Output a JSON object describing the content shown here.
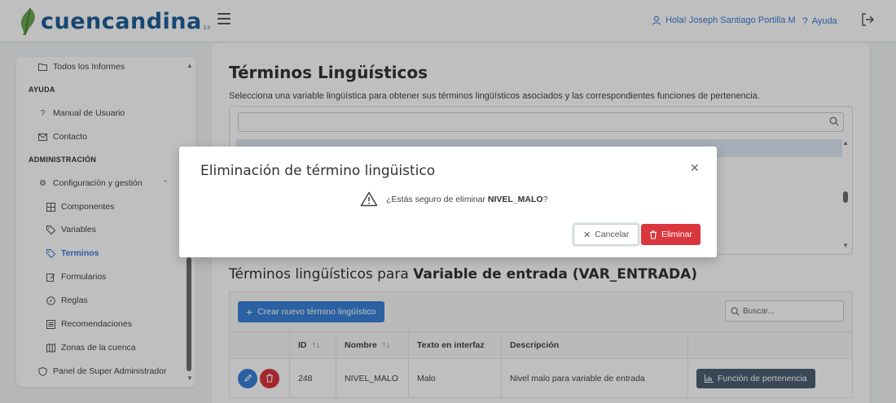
{
  "header": {
    "brand": "cuencandina",
    "version": "2.0",
    "greeting": "Hola! Joseph Santiago Portilla M",
    "help": "Ayuda",
    "brand_color": "#1f5f99",
    "link_color": "#3a7bd5"
  },
  "sidebar": {
    "items": [
      {
        "label": "Todos los Informes",
        "icon": "folder-icon"
      },
      {
        "label": "AYUDA",
        "heading": true
      },
      {
        "label": "Manual de Usuario",
        "icon": "question-icon"
      },
      {
        "label": "Contacto",
        "icon": "mail-icon"
      },
      {
        "label": "ADMINISTRACIÓN",
        "heading": true
      },
      {
        "label": "Configuración y gestión",
        "icon": "gear-icon"
      },
      {
        "label": "Componentes",
        "icon": "grid-icon"
      },
      {
        "label": "Variables",
        "icon": "tag-icon"
      },
      {
        "label": "Terminos",
        "icon": "tags-icon",
        "active": true
      },
      {
        "label": "Formularios",
        "icon": "edit-icon"
      },
      {
        "label": "Reglas",
        "icon": "compass-icon"
      },
      {
        "label": "Recomendaciones",
        "icon": "list-icon"
      },
      {
        "label": "Zonas de la cuenca",
        "icon": "map-icon"
      },
      {
        "label": "Panel de Super Administrador",
        "icon": "shield-icon"
      }
    ]
  },
  "main": {
    "title": "Términos Lingüísticos",
    "description": "Selecciona una variable lingüística para obtener sus términos lingüísticos asociados y las correspondientes funciones de pertenencia.",
    "subtitle_prefix": "Términos lingüísticos para ",
    "subtitle_variable": "Variable de entrada (VAR_ENTRADA)",
    "create_button": "Crear nuevo término lingüístico",
    "search_placeholder": "Buscar...",
    "table": {
      "columns": [
        "",
        "ID",
        "Nombre",
        "Texto en interfaz",
        "Descripción",
        ""
      ],
      "rows": [
        {
          "id": "248",
          "nombre": "NIVEL_MALO",
          "texto": "Malo",
          "descripcion": "Nivel malo para variable de entrada",
          "action": "Función de pertenencia"
        }
      ]
    }
  },
  "modal": {
    "title": "Eliminación de término lingüistico",
    "message_prefix": "¿Estás seguro de eliminar ",
    "message_term": "NIVEL_MALO",
    "message_suffix": "?",
    "cancel": "Cancelar",
    "delete": "Eliminar",
    "danger_color": "#d9363e"
  }
}
